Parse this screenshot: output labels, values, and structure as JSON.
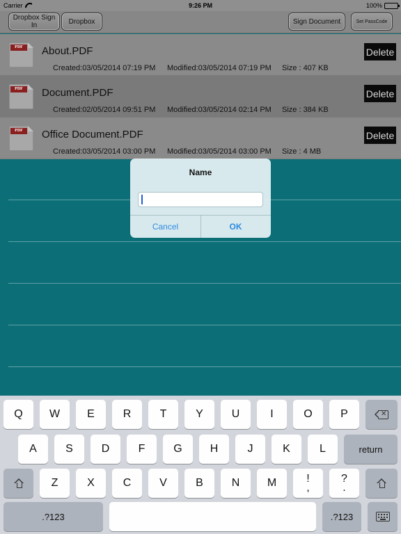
{
  "statusbar": {
    "carrier": "Carrier",
    "time": "9:26 PM",
    "battery": "100%"
  },
  "toolbar": {
    "dropbox_signin": "Dropbox Sign In",
    "dropbox": "Dropbox",
    "sign_document": "Sign Document",
    "set_passcode": "Set PassCode"
  },
  "files": [
    {
      "name": "About.PDF",
      "created": "Created:03/05/2014 07:19 PM",
      "modified": "Modified:03/05/2014 07:19 PM",
      "size": "Size : 407 KB",
      "delete": "Delete",
      "icon_tag": "PDF"
    },
    {
      "name": "Document.PDF",
      "created": "Created:02/05/2014 09:51 PM",
      "modified": "Modified:03/05/2014 02:14 PM",
      "size": "Size : 384 KB",
      "delete": "Delete",
      "icon_tag": "PDF"
    },
    {
      "name": "Office Document.PDF",
      "created": "Created:03/05/2014 03:00 PM",
      "modified": "Modified:03/05/2014 03:00 PM",
      "size": "Size : 4 MB",
      "delete": "Delete",
      "icon_tag": "PDF"
    }
  ],
  "dialog": {
    "title": "Name",
    "value": "",
    "cancel": "Cancel",
    "ok": "OK"
  },
  "keyboard": {
    "row1": [
      "Q",
      "W",
      "E",
      "R",
      "T",
      "Y",
      "U",
      "I",
      "O",
      "P"
    ],
    "row2": [
      "A",
      "S",
      "D",
      "F",
      "G",
      "H",
      "J",
      "K",
      "L"
    ],
    "row3": [
      "Z",
      "X",
      "C",
      "V",
      "B",
      "N",
      "M"
    ],
    "return": "return",
    "num_left": ".?123",
    "num_right": ".?123",
    "excl_top": "!",
    "excl_bottom": ",",
    "quest_top": "?",
    "quest_bottom": "."
  },
  "colors": {
    "background": "#0c6f78",
    "accent": "#2e8be0"
  }
}
